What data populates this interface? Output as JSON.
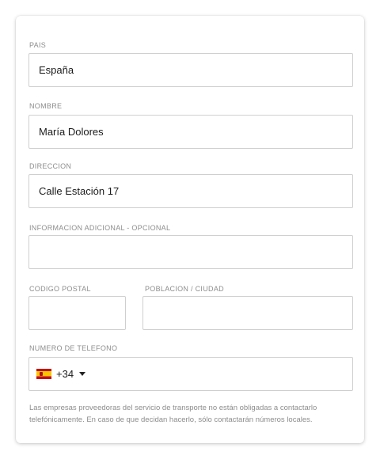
{
  "form": {
    "country": {
      "label": "PAIS",
      "value": "España"
    },
    "name": {
      "label": "NOMBRE",
      "value": "María Dolores"
    },
    "address": {
      "label": "DIRECCION",
      "value": "Calle Estación 17"
    },
    "additional": {
      "label": "INFORMACION ADICIONAL - OPCIONAL",
      "value": ""
    },
    "postal_code": {
      "label": "CODIGO POSTAL",
      "value": ""
    },
    "city": {
      "label": "POBLACION / CIUDAD",
      "value": ""
    },
    "phone": {
      "label": "NUMERO DE TELEFONO",
      "country_icon": "spain-flag-icon",
      "dial_code": "+34",
      "value": ""
    },
    "note": "Las empresas proveedoras del servicio de transporte no están obligadas a contactarlo telefónicamente. En caso de que decidan hacerlo, sólo contactarán números locales."
  }
}
